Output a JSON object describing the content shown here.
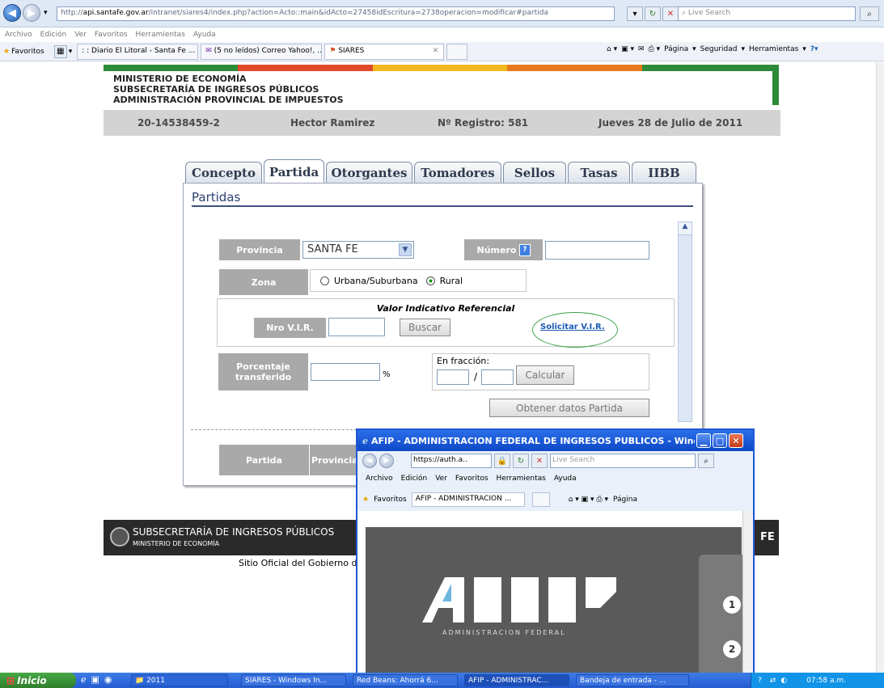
{
  "browser": {
    "url_prefix": "http://",
    "url_host": "api.santafe.gov.ar",
    "url_rest": "/intranet/siares4/index.php?action=Acto::main&idActo=27458idEscritura=2738operacion=modificar#partida",
    "search_placeholder": "Live Search",
    "menu": [
      "Archivo",
      "Edición",
      "Ver",
      "Favoritos",
      "Herramientas",
      "Ayuda"
    ],
    "favorites_label": "Favoritos",
    "tabs": [
      ": : Diario El Litoral - Santa Fe ...",
      "(5 no leídos) Correo Yahoo!, ...",
      "SIARES"
    ],
    "toolbar_right": [
      "Página",
      "Seguridad",
      "Herramientas"
    ]
  },
  "header": {
    "org_line1": "MINISTERIO DE ECONOMÍA",
    "org_line2": "SUBSECRETARÍA DE INGRESOS PÚBLICOS",
    "org_line3": "ADMINISTRACIÓN PROVINCIAL DE IMPUESTOS",
    "colors": [
      "#2e8b3a",
      "#e04a2a",
      "#f2b81f",
      "#e87b1e",
      "#2e8b3a"
    ],
    "cuit": "20-14538459-2",
    "name": "Hector Ramirez",
    "registro": "Nº Registro: 581",
    "date": "Jueves 28 de Julio de 2011"
  },
  "tabs": [
    "Concepto",
    "Partida",
    "Otorgantes",
    "Tomadores",
    "Sellos",
    "Tasas",
    "IIBB"
  ],
  "form": {
    "title": "Partidas",
    "provincia_label": "Provincia",
    "provincia_value": "SANTA FE",
    "numero_label": "Número",
    "zona_label": "Zona",
    "zona_opt1": "Urbana/Suburbana",
    "zona_opt2": "Rural",
    "vir_title": "Valor Indicativo Referencial",
    "vir_label": "Nro V.I.R.",
    "buscar": "Buscar",
    "solicitar": "Solicitar V.I.R.",
    "porcentaje_label_1": "Porcentaje",
    "porcentaje_label_2": "transferido",
    "percent": "%",
    "fraccion_label": "En fracción:",
    "slash": "/",
    "calcular": "Calcular",
    "obtener": "Obtener datos Partida",
    "col_partida": "Partida",
    "col_provincia": "Provincia"
  },
  "footer": {
    "line1": "SUBSECRETARÍA DE INGRESOS PÚBLICOS",
    "line2": "MINISTERIO DE ECONOMÍA",
    "sitio": "Sitio Oficial del Gobierno d",
    "fe": "FE"
  },
  "popup": {
    "title": "AFIP - ADMINISTRACION FEDERAL DE INGRESOS PUBLICOS - Windows Inter...",
    "url": "https://auth.a..",
    "search": "Live Search",
    "menu": [
      "Archivo",
      "Edición",
      "Ver",
      "Favoritos",
      "Herramientas",
      "Ayuda"
    ],
    "favorites": "Favoritos",
    "tab": "AFIP - ADMINISTRACION ...",
    "pagina": "Página",
    "afip_sub": "ADMINISTRACION FEDERAL",
    "step1": "1",
    "step2": "2"
  },
  "taskbar": {
    "start": "Inicio",
    "folder": "2011",
    "items": [
      "SIARES - Windows In...",
      "Red Beans: Ahorrá 6...",
      "AFIP - ADMINISTRAC...",
      "Bandeja de entrada - ..."
    ],
    "clock": "07:58 a.m."
  }
}
